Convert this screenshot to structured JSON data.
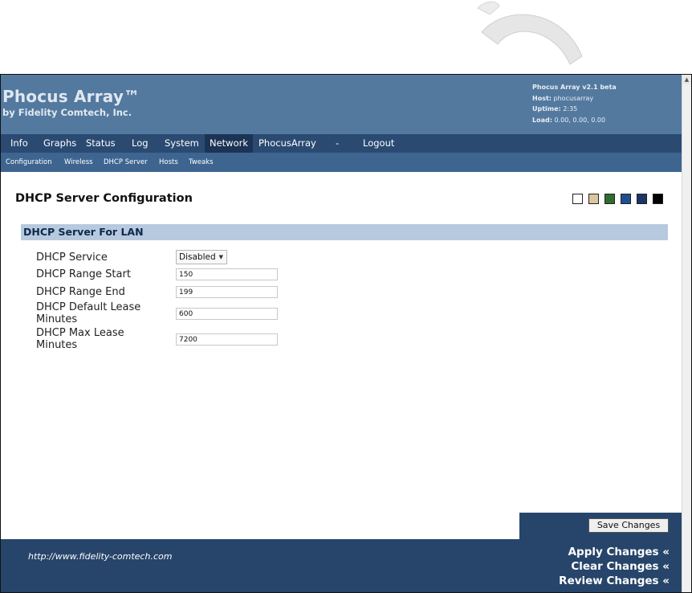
{
  "header": {
    "title": "Phocus Array™",
    "subtitle": "by Fidelity Comtech, Inc.",
    "version": "Phocus Array v2.1 beta",
    "host_label": "Host:",
    "host_value": "phocusarray",
    "uptime_label": "Uptime:",
    "uptime_value": "2:35",
    "load_label": "Load:",
    "load_value": "0.00, 0.00, 0.00"
  },
  "nav": {
    "items": [
      "Info",
      "Graphs",
      "Status",
      "Log",
      "System",
      "Network",
      "PhocusArray",
      "-",
      "Logout"
    ],
    "active": "Network"
  },
  "subnav": {
    "items": [
      "Configuration",
      "Wireless",
      "DHCP Server",
      "Hosts",
      "Tweaks"
    ]
  },
  "page": {
    "title": "DHCP Server Configuration",
    "swatches": [
      "#ffffff",
      "#dcc6a0",
      "#2f6d2f",
      "#1f4f8f",
      "#1c3466",
      "#000000"
    ]
  },
  "section": {
    "title": "DHCP Server For LAN"
  },
  "form": {
    "service_label": "DHCP Service",
    "service_value": "Disabled",
    "range_start_label": "DHCP Range Start",
    "range_start_value": "150",
    "range_end_label": "DHCP Range End",
    "range_end_value": "199",
    "default_lease_label_1": "DHCP Default Lease",
    "default_lease_label_2": "Minutes",
    "default_lease_value": "600",
    "max_lease_label_1": "DHCP Max Lease",
    "max_lease_label_2": "Minutes",
    "max_lease_value": "7200"
  },
  "footer": {
    "save_label": "Save Changes",
    "url": "http://www.fidelity-comtech.com",
    "apply": "Apply Changes «",
    "clear": "Clear Changes «",
    "review": "Review Changes «"
  }
}
